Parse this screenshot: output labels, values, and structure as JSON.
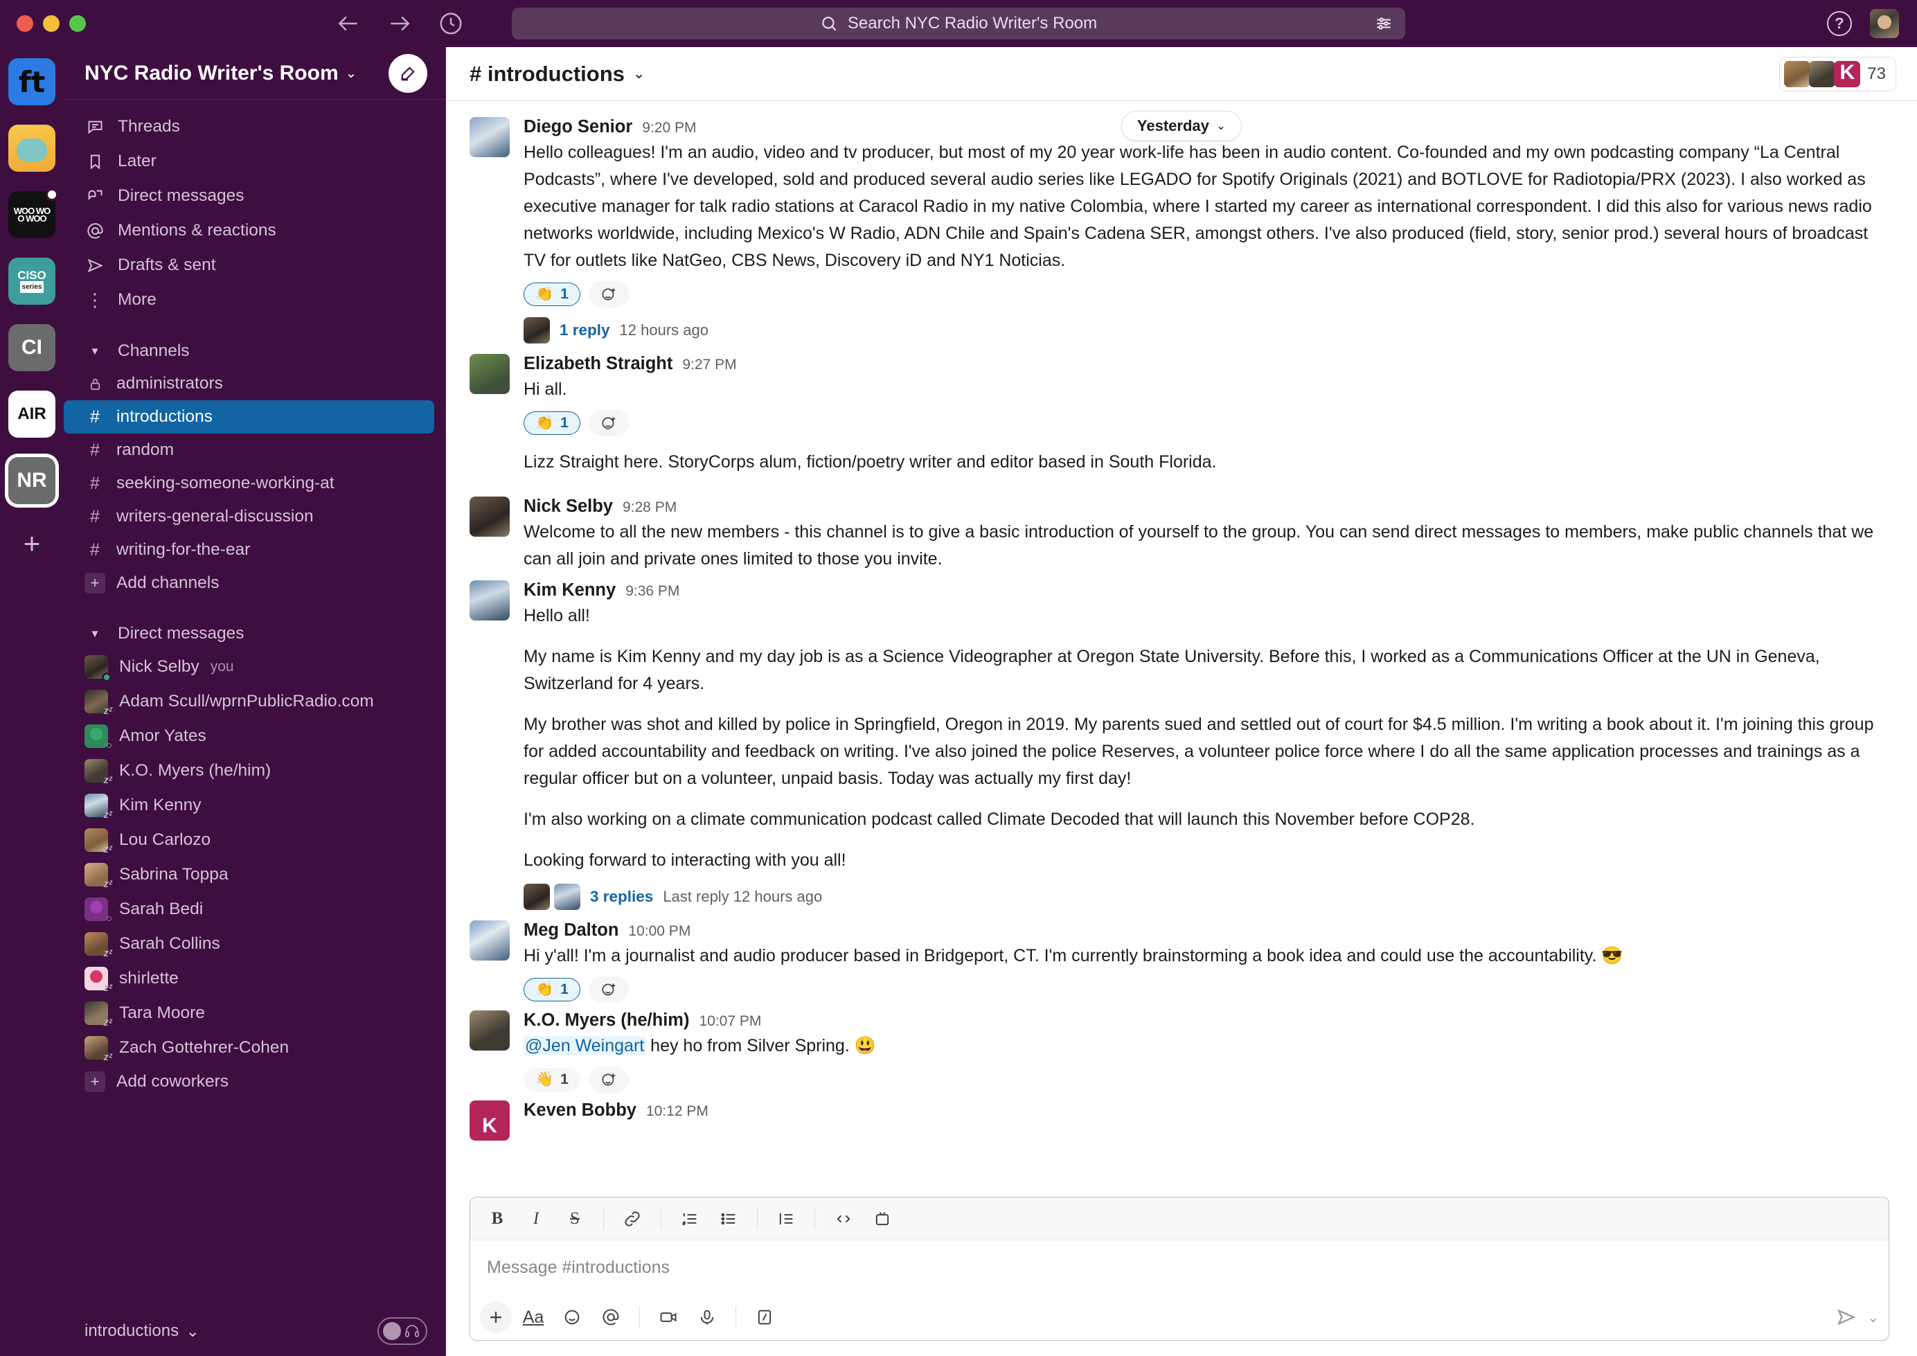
{
  "window": {
    "search_placeholder": "Search NYC Radio Writer's Room",
    "help_label": "?"
  },
  "workspace": {
    "name": "NYC Radio Writer's Room",
    "chevron": "⌄",
    "rail": [
      {
        "label": "ft",
        "name": "workspace-ft"
      },
      {
        "label": "",
        "name": "workspace-hippo"
      },
      {
        "label": "WOO WOO WOO",
        "name": "workspace-woo"
      },
      {
        "label": "CISO",
        "sub": "series",
        "name": "workspace-ciso"
      },
      {
        "label": "CI",
        "name": "workspace-ci"
      },
      {
        "label": "AIR",
        "name": "workspace-air"
      },
      {
        "label": "NR",
        "name": "workspace-nr"
      }
    ],
    "add_workspace": "+"
  },
  "sidebar": {
    "nav": [
      {
        "label": "Threads",
        "icon": "threads-icon"
      },
      {
        "label": "Later",
        "icon": "bookmark-icon"
      },
      {
        "label": "Direct messages",
        "icon": "direct-messages-icon"
      },
      {
        "label": "Mentions & reactions",
        "icon": "at-icon"
      },
      {
        "label": "Drafts & sent",
        "icon": "paper-plane-icon"
      },
      {
        "label": "More",
        "icon": "more-icon"
      }
    ],
    "channels_section": {
      "title": "Channels",
      "items": [
        {
          "label": "administrators",
          "prefix": "lock",
          "active": false
        },
        {
          "label": "introductions",
          "prefix": "hash",
          "active": true
        },
        {
          "label": "random",
          "prefix": "hash",
          "active": false
        },
        {
          "label": "seeking-someone-working-at",
          "prefix": "hash",
          "active": false
        },
        {
          "label": "writers-general-discussion",
          "prefix": "hash",
          "active": false
        },
        {
          "label": "writing-for-the-ear",
          "prefix": "hash",
          "active": false
        }
      ],
      "add_label": "Add channels"
    },
    "dms_section": {
      "title": "Direct messages",
      "items": [
        {
          "label": "Nick Selby",
          "suffix": "you",
          "presence": "online",
          "av": "p1"
        },
        {
          "label": "Adam Scull/wprnPublicRadio.com",
          "suffix": "",
          "presence": "away",
          "av": "p2"
        },
        {
          "label": "Amor Yates",
          "suffix": "",
          "presence": "offline",
          "av": "p14"
        },
        {
          "label": "K.O. Myers (he/him)",
          "suffix": "",
          "presence": "away",
          "av": "p9"
        },
        {
          "label": "Kim Kenny",
          "suffix": "",
          "presence": "away",
          "av": "p3"
        },
        {
          "label": "Lou Carlozo",
          "suffix": "",
          "presence": "away",
          "av": "p7"
        },
        {
          "label": "Sabrina Toppa",
          "suffix": "",
          "presence": "away",
          "av": "p10"
        },
        {
          "label": "Sarah Bedi",
          "suffix": "",
          "presence": "offline",
          "av": "p13"
        },
        {
          "label": "Sarah Collins",
          "suffix": "",
          "presence": "away",
          "av": "p8"
        },
        {
          "label": "shirlette",
          "suffix": "",
          "presence": "away",
          "av": "p15"
        },
        {
          "label": "Tara Moore",
          "suffix": "",
          "presence": "away",
          "av": "p12"
        },
        {
          "label": "Zach Gottehrer-Cohen",
          "suffix": "",
          "presence": "away",
          "av": "p4"
        }
      ],
      "add_label": "Add coworkers"
    },
    "footer": {
      "label": "introductions",
      "chevron": "⌄"
    }
  },
  "channel": {
    "title": "# introductions",
    "chevron": "⌄",
    "member_count": "73",
    "date_divider": "Yesterday",
    "date_divider_chevron": "⌄"
  },
  "messages": [
    {
      "author": "Diego Senior",
      "time": "9:20 PM",
      "av": "p5",
      "paragraphs": [
        "Hello colleagues! I'm an audio, video and tv producer, but most of my 20 year work-life has been in audio content. Co-founded and my own podcasting company “La Central Podcasts”, where I've developed, sold and produced several audio series like LEGADO for Spotify Originals (2021) and BOTLOVE for Radiotopia/PRX (2023). I also worked as executive manager for talk radio stations at Caracol Radio in my native Colombia, where I started my career as international correspondent. I did this also for various news radio networks worldwide, including Mexico's W Radio, ADN Chile and Spain's Cadena SER, amongst others. I've also produced (field, story, senior prod.) several hours of broadcast TV for outlets like NatGeo, CBS News, Discovery iD and NY1 Noticias."
      ],
      "reaction_emoji": "👏",
      "reaction_count": "1",
      "reaction_on": true,
      "thread_link": "1 reply",
      "thread_meta": "12 hours ago"
    },
    {
      "author": "Elizabeth Straight",
      "time": "9:27 PM",
      "av": "p6",
      "paragraphs": [
        "Hi all."
      ],
      "reaction_emoji": "👏",
      "reaction_count": "1",
      "reaction_on": true,
      "followup": "Lizz Straight here. StoryCorps alum, fiction/poetry writer and editor based in South Florida."
    },
    {
      "author": "Nick Selby",
      "time": "9:28 PM",
      "av": "p1",
      "paragraphs": [
        "Welcome to all the new members - this channel is to give a basic introduction of yourself to the group. You can send direct messages to members, make public channels that we can all join and private ones limited to those you invite."
      ]
    },
    {
      "author": "Kim Kenny",
      "time": "9:36 PM",
      "av": "p3",
      "paragraphs": [
        "Hello all!",
        "My name is Kim Kenny and my day job is as a Science Videographer at Oregon State University. Before this, I worked as a Communications Officer at the UN in Geneva, Switzerland for 4 years.",
        "My brother was shot and killed by police in Springfield, Oregon in 2019. My parents sued and settled out of court for $4.5 million. I'm writing a book about it. I'm joining this group for added accountability and feedback on writing. I've also joined the police Reserves, a volunteer police force where I do all the same application processes and trainings as a regular officer but on a volunteer, unpaid basis. Today was actually my first day!",
        "I'm also working on a climate communication podcast called Climate Decoded that will launch this November before COP28.",
        "Looking forward to interacting with you all!"
      ],
      "thread_link": "3 replies",
      "thread_meta": "Last reply 12 hours ago"
    },
    {
      "author": "Meg Dalton",
      "time": "10:00 PM",
      "av": "p11",
      "paragraphs": [
        "Hi y'all! I'm a journalist and audio producer based in Bridgeport, CT. I'm currently brainstorming a book idea and could use the accountability. 😎"
      ],
      "reaction_emoji": "👏",
      "reaction_count": "1",
      "reaction_on": true
    },
    {
      "author": "K.O. Myers (he/him)",
      "time": "10:07 PM",
      "av": "p9",
      "mention": "@Jen Weingart",
      "paragraphs": [
        " hey ho from Silver Spring. 😃"
      ],
      "reaction_emoji": "👋",
      "reaction_count": "1",
      "reaction_on": false
    },
    {
      "author": "Keven Bobby",
      "time": "10:12 PM",
      "av": "kavatar",
      "paragraphs": []
    }
  ],
  "composer": {
    "placeholder": "Message #introductions",
    "format_buttons": [
      "bold",
      "italic",
      "strikethrough",
      "link",
      "ordered-list",
      "bulleted-list",
      "blockquote",
      "code",
      "code-block"
    ],
    "action_buttons": [
      "plus",
      "formatting",
      "emoji",
      "mention",
      "video",
      "audio",
      "shortcuts"
    ]
  }
}
